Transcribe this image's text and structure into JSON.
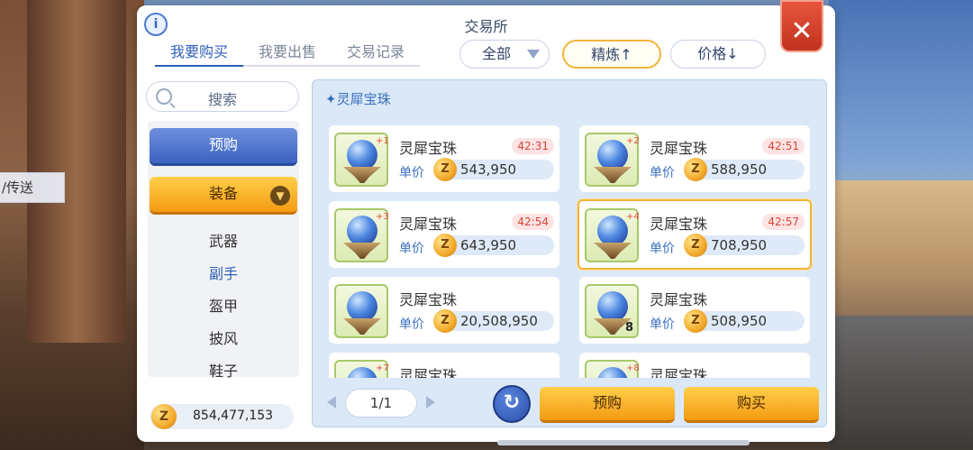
{
  "background": {
    "teleport_label": "/传送"
  },
  "panel": {
    "title": "交易所",
    "info_icon": "info-icon",
    "close_symbol": "✕",
    "tabs": [
      {
        "label": "我要购买",
        "active": true
      },
      {
        "label": "我要出售",
        "active": false
      },
      {
        "label": "交易记录",
        "active": false
      }
    ],
    "filters": {
      "category": "全部",
      "refine_sort": "精炼↑",
      "price_sort": "价格↓"
    }
  },
  "sidebar": {
    "search_label": "搜索",
    "preorder_label": "预购",
    "equipment_label": "装备",
    "submenu": [
      {
        "label": "武器",
        "active": false
      },
      {
        "label": "副手",
        "active": true
      },
      {
        "label": "盔甲",
        "active": false
      },
      {
        "label": "披风",
        "active": false
      },
      {
        "label": "鞋子",
        "active": false
      }
    ],
    "currency": {
      "coin_symbol": "Z",
      "amount": "854,477,153"
    }
  },
  "listing": {
    "category_label": "✦灵犀宝珠",
    "price_label": "单价",
    "items": [
      {
        "name": "灵犀宝珠",
        "refine": "+1",
        "time": "42:31",
        "price": "543,950",
        "count": "",
        "selected": false
      },
      {
        "name": "灵犀宝珠",
        "refine": "+2",
        "time": "42:51",
        "price": "588,950",
        "count": "",
        "selected": false
      },
      {
        "name": "灵犀宝珠",
        "refine": "+3",
        "time": "42:54",
        "price": "643,950",
        "count": "",
        "selected": false
      },
      {
        "name": "灵犀宝珠",
        "refine": "+4",
        "time": "42:57",
        "price": "708,950",
        "count": "",
        "selected": true
      },
      {
        "name": "灵犀宝珠",
        "refine": "",
        "time": "",
        "price": "20,508,950",
        "count": "",
        "selected": false
      },
      {
        "name": "灵犀宝珠",
        "refine": "",
        "time": "",
        "price": "508,950",
        "count": "8",
        "selected": false
      },
      {
        "name": "灵犀宝珠",
        "refine": "+7",
        "time": "",
        "price": "",
        "count": "",
        "selected": false
      },
      {
        "name": "灵犀宝珠",
        "refine": "+8",
        "time": "",
        "price": "",
        "count": "",
        "selected": false
      }
    ]
  },
  "footer": {
    "page": "1/1",
    "refresh_symbol": "↻",
    "preorder_button": "预购",
    "buy_button": "购买"
  },
  "colors": {
    "accent_blue": "#2e5fb8",
    "accent_orange": "#f49a12",
    "timer_red": "#d6453a",
    "close_red": "#e8553c"
  }
}
